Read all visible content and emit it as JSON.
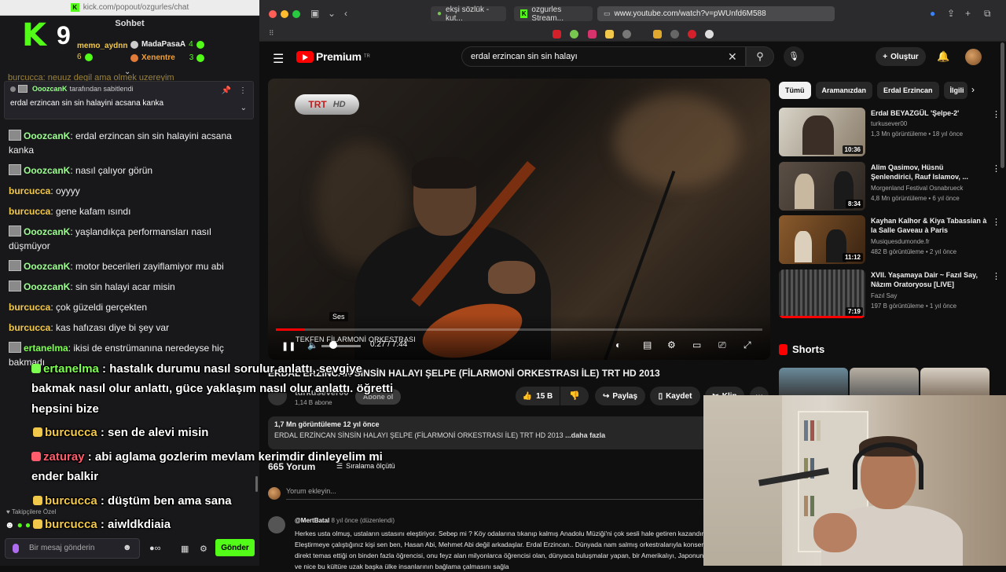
{
  "chat_window": {
    "url": "kick.com/popout/ozgurles/chat",
    "header": "Sohbet",
    "leaderboard": {
      "number": "9",
      "users": [
        {
          "name": "memo_aydnn",
          "value": "6"
        },
        {
          "name": "MadaPasaA",
          "value": "4"
        },
        {
          "name": "Xenentre",
          "value": "3"
        }
      ]
    },
    "cut_line": "burcucca: neuuz degil ama olmek uzereyim",
    "pinned": {
      "by_user": "OoozcanK",
      "by_suffix": "tarafından sabitlendi",
      "message": "erdal erzincan sin sin halayini acsana kanka"
    },
    "messages": [
      {
        "user": "OoozcanK",
        "cls": "u-ozk",
        "avatar": true,
        "text": "erdal erzincan sin sin halayini acsana kanka"
      },
      {
        "user": "OoozcanK",
        "cls": "u-ozk",
        "avatar": true,
        "text": "nasıl çalıyor görün"
      },
      {
        "user": "burcucca",
        "cls": "u-bur",
        "avatar": false,
        "text": "oyyyy"
      },
      {
        "user": "burcucca",
        "cls": "u-bur",
        "avatar": false,
        "text": "gene kafam ısındı"
      },
      {
        "user": "OoozcanK",
        "cls": "u-ozk",
        "avatar": true,
        "text": "yaşlandıkça performansları nasıl düşmüyor"
      },
      {
        "user": "OoozcanK",
        "cls": "u-ozk",
        "avatar": true,
        "text": "motor becerileri zayiflamiyor mu abi"
      },
      {
        "user": "OoozcanK",
        "cls": "u-ozk",
        "avatar": true,
        "text": "sin sin halayi acar misin"
      },
      {
        "user": "burcucca",
        "cls": "u-bur",
        "avatar": false,
        "text": "çok güzeldi gerçekten"
      },
      {
        "user": "burcucca",
        "cls": "u-bur",
        "avatar": false,
        "text": "kas hafızası diye bi şey var"
      },
      {
        "user": "ertanelma",
        "cls": "u-ert",
        "avatar": true,
        "text": "ikisi de enstrümanına neredeyse hiç bakmadı"
      }
    ],
    "followers_tag": "Takipçilere Özel",
    "input_placeholder": "Bir mesaj gönderin",
    "send_label": "Gönder"
  },
  "browser": {
    "tabs": [
      {
        "label": "ekşi sözlük - kut..."
      },
      {
        "label": "ozgurles Stream..."
      },
      {
        "label": "www.youtube.com/watch?v=pWUnfd6M588"
      }
    ]
  },
  "youtube": {
    "logo_text": "Premium",
    "logo_sup": "TR",
    "search_query": "erdal erzincan sin sin halayı",
    "create_label": "Oluştur",
    "player": {
      "channel_bug": "TRT",
      "channel_bug_hd": "HD",
      "tooltip": "Ses",
      "caption": "TEKFEN FİLARMONİ ORKESTRASI",
      "time": "0:27 / 7:44",
      "progress": 0.058
    },
    "video_title": "ERDAL ERZİNCAN SİNSİN HALAYI ŞELPE (FİLARMONİ ORKESTRASI İLE) TRT HD 2013",
    "channel_name": "turkusever00",
    "subscribers": "1,14 B abone",
    "subscribe_label": "Abone ol",
    "likes": "15 B",
    "share_label": "Paylaş",
    "save_label": "Kaydet",
    "clip_label": "Klip",
    "description": {
      "stats": "1,7 Mn görüntüleme  12 yıl önce",
      "text": "ERDAL ERZİNCAN SİNSİN HALAYI ŞELPE (FİLARMONİ ORKESTRASI İLE) TRT HD 2013 ",
      "more": "...daha fazla"
    },
    "comments_count": "665 Yorum",
    "sort_label": "Sıralama ölçütü",
    "comment_placeholder": "Yorum ekleyin...",
    "top_comment": {
      "user": "@MertBatal",
      "meta": "8 yıl önce (düzenlendi)",
      "text": "Herkes usta olmuş, ustaların ustasını eleştiriyor. Sebep mi ? Köy odalarına tıkanıp kalmış Anadolu Müziği'ni çok sesli hale getiren kazandırması. Eleştirmeye çalıştığınız kişi sen ben, Hasan Abi, Mehmet Abi değil arkadaşlar. Erdal Erzincan.. Dünyada nam salmış orkestralarıyla konserler veren, direkt temas ettiği on binden fazla öğrencisi, onu feyz alan milyonlarca öğrencisi olan, dünyaca buluşmalar yapan, bir Amerikalıyı, Japonun, Almanın ve nice bu kültüre uzak başka ülke insanlarının bağlama çalmasını sağla"
    },
    "chips": [
      "Tümü",
      "Aramanızdan",
      "Erdal Erzincan",
      "İlgili"
    ],
    "recommendations": [
      {
        "title": "Erdal BEYAZGÜL 'Şelpe-2'",
        "channel": "turkusever00",
        "meta": "1,3 Mn görüntüleme • 18 yıl önce",
        "duration": "10:36"
      },
      {
        "title": "Alim Qasimov, Hüsnü Şenlendirici, Rauf Islamov, ...",
        "channel": "Morgenland Festival Osnabrueck",
        "meta": "4,8 Mn görüntüleme • 6 yıl önce",
        "duration": "8:34"
      },
      {
        "title": "Kayhan Kalhor & Kiya Tabassian à la Salle Gaveau à Paris",
        "channel": "Musiquesdumonde.fr",
        "meta": "482 B görüntüleme • 2 yıl önce",
        "duration": "11:12"
      },
      {
        "title": "XVII. Yaşamaya Dair ~ Fazıl Say, Nâzım Oratoryosu [LIVE]",
        "channel": "Fazıl Say",
        "meta": "197 B görüntüleme • 1 yıl önce",
        "duration": "7:19"
      }
    ],
    "shorts_label": "Shorts"
  },
  "overlay_captions": [
    {
      "user": "ertanelma",
      "color": "#7cff4f",
      "text": " : hastalık durumu nasıl sorulur anlattı, sevgiye"
    },
    {
      "user": "",
      "color": "#fff",
      "text": "bakmak nasıl olur anlattı, güce yaklaşım nasıl olur anlattı. öğretti"
    },
    {
      "user": "",
      "color": "#fff",
      "text": "hepsini bize"
    },
    {
      "user": "burcucca",
      "color": "#f2c84b",
      "text": " : sen de alevi misin"
    },
    {
      "user": "zaturay",
      "color": "#ff5d6c",
      "text": " : abi aglama gozlerim mevlam kerimdir dinleyelim mi"
    },
    {
      "user": "",
      "color": "#fff",
      "text": "ender balkir"
    },
    {
      "user": "burcucca",
      "color": "#f2c84b",
      "text": " : düştüm ben ama sana"
    },
    {
      "user": "burcucca",
      "color": "#f2c84b",
      "text": " : aiwldkdiaia"
    }
  ],
  "colors": {
    "kick_green": "#53fc18",
    "yt_red": "#ff0000"
  }
}
